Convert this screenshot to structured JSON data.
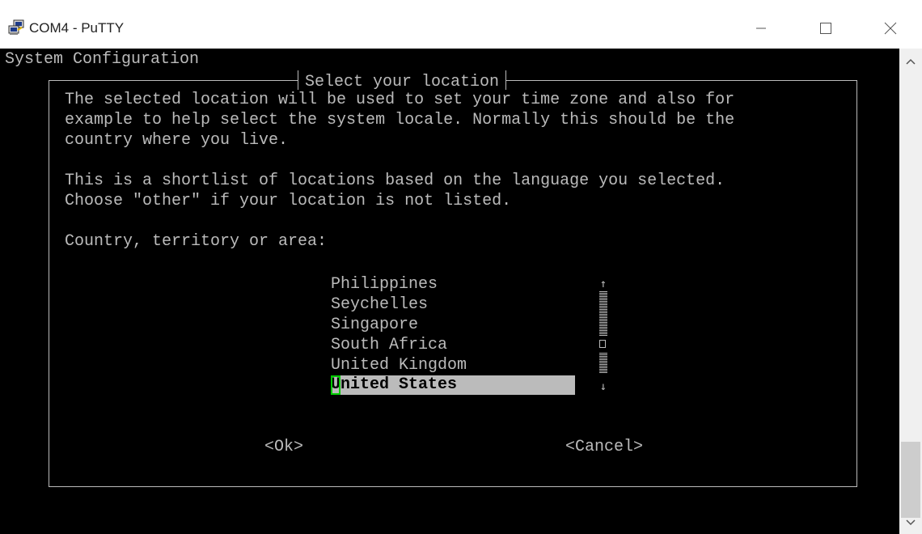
{
  "window": {
    "title": "COM4 - PuTTY"
  },
  "terminal": {
    "header": "System Configuration",
    "dialog_title": "Select your location",
    "description_lines": [
      "The selected location will be used to set your time zone and also for",
      "example to help select the system locale. Normally this should be the",
      "country where you live.",
      "This is a shortlist of locations based on the language you selected.",
      "Choose \"other\" if your location is not listed."
    ],
    "prompt": "Country, territory or area:",
    "locations": [
      "Philippines",
      "Seychelles",
      "Singapore",
      "South Africa",
      "United Kingdom",
      "United States"
    ],
    "selected_location": "United States",
    "ok_button": "<Ok>",
    "cancel_button": "<Cancel>"
  },
  "colors": {
    "terminal_bg": "#000000",
    "terminal_fg": "#bbbbbb",
    "selection_bg": "#bbbbbb",
    "cursor": "#00cc00"
  },
  "icons": [
    "putty-icon",
    "minimize-icon",
    "maximize-icon",
    "close-icon",
    "scroll-up-arrow-icon",
    "scroll-down-arrow-icon"
  ]
}
